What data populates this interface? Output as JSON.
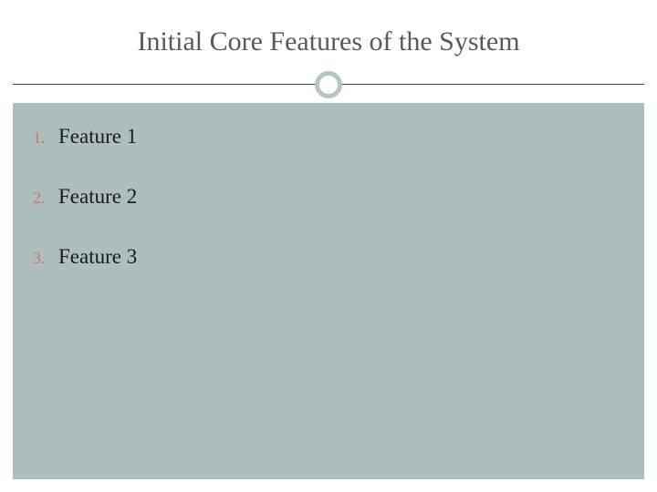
{
  "title": "Initial Core Features of the System",
  "items": [
    {
      "number": "1.",
      "text": "Feature 1"
    },
    {
      "number": "2.",
      "text": "Feature 2"
    },
    {
      "number": "3.",
      "text": "Feature 3"
    }
  ]
}
